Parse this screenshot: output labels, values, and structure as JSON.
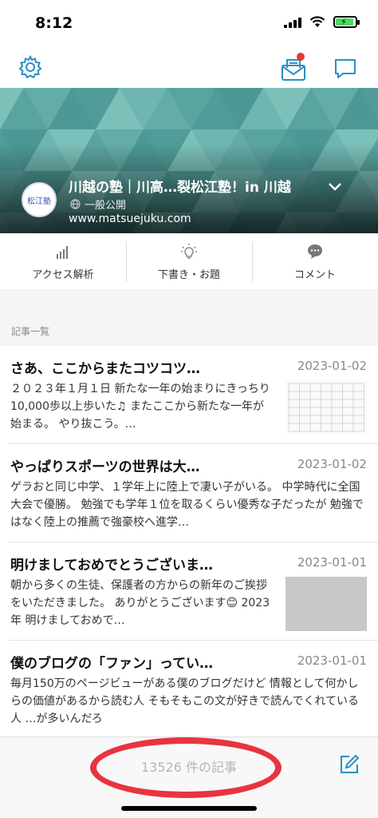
{
  "status_bar": {
    "time": "8:12"
  },
  "blog": {
    "title": "川越の塾｜川高…裂松江塾！in 川越",
    "visibility": "一般公開",
    "url": "www.matsuejuku.com",
    "avatar_text": "松江塾"
  },
  "actions": [
    {
      "label": "アクセス解析",
      "icon": "bar-chart-icon"
    },
    {
      "label": "下書き・お題",
      "icon": "lightbulb-icon"
    },
    {
      "label": "コメント",
      "icon": "speech-bubble-icon"
    }
  ],
  "section_label": "記事一覧",
  "articles": [
    {
      "title": "さあ、ここからまたコツコツ…",
      "date": "2023-01-02",
      "excerpt": "２０２３年１月１日 新たな一年の始まりにきっちり10,000歩以上歩いた♫ またここから新たな一年が始まる。 やり抜こう。…",
      "thumbnail": "calendar"
    },
    {
      "title": "やっぱりスポーツの世界は大…",
      "date": "2023-01-02",
      "excerpt": "ゲラおと同じ中学、１学年上に陸上で凄い子がいる。 中学時代に全国大会で優勝。 勉強でも学年１位を取るくらい優秀な子だったが 勉強ではなく陸上の推薦で強豪校へ進学…",
      "thumbnail": "none"
    },
    {
      "title": "明けましておめでとうございま…",
      "date": "2023-01-01",
      "excerpt": "朝から多くの生徒、保護者の方からの新年のご挨拶をいただきました。 ありがとうございます😊 2023年 明けましておめで…",
      "thumbnail": "gray"
    },
    {
      "title": "僕のブログの「ファン」ってい…",
      "date": "2023-01-01",
      "excerpt": "毎月150万のページビューがある僕のブログだけど 情報として何かしらの価値があるから読む人 そもそもこの文が好きで読んでくれている人 …が多いんだろ",
      "thumbnail": "none"
    }
  ],
  "bottom": {
    "count": "13526 件の記事"
  },
  "colors": {
    "accent": "#2a8fc4",
    "annotation": "#e8343e",
    "banner": "#5aa4a0"
  }
}
